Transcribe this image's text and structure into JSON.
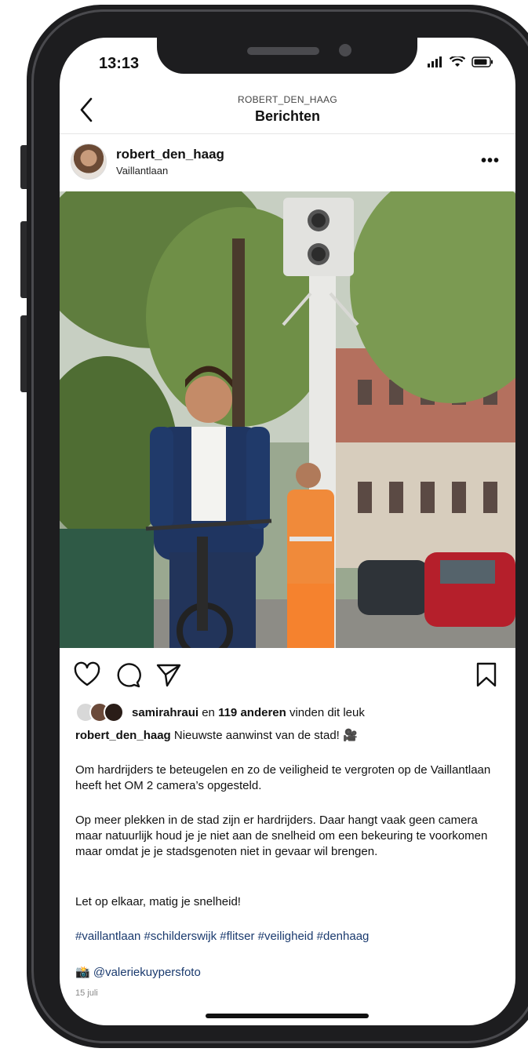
{
  "status_bar": {
    "time": "13:13"
  },
  "nav": {
    "subtitle": "ROBERT_DEN_HAAG",
    "title": "Berichten"
  },
  "post": {
    "username": "robert_den_haag",
    "location": "Vaillantlaan",
    "more_label": "•••",
    "likes": {
      "user": "samirahraui",
      "connector": " en ",
      "count_text": "119 anderen",
      "suffix": " vinden dit leuk"
    },
    "caption_user": "robert_den_haag",
    "caption_first": " Nieuwste aanwinst van de stad! 🎥",
    "paragraph1": "Om hardrijders te beteugelen en zo de veiligheid te vergroten op de Vaillantlaan heeft het OM 2 camera’s opgesteld.",
    "paragraph2": "Op meer plekken in de stad zijn er hardrijders. Daar hangt vaak geen camera maar natuurlijk houd je je niet aan de snelheid om een bekeuring te voorkomen maar omdat je je stadsgenoten niet in gevaar wil brengen.",
    "paragraph3": "Let op elkaar, matig je snelheid!",
    "hashtags": "#vaillantlaan #schilderswijk #flitser #veiligheid #denhaag",
    "credit_emoji": "📸",
    "credit_handle": "@valeriekuypersfoto",
    "date": "15 juli"
  },
  "icons": {
    "back": "chevron-left-icon",
    "like": "heart-icon",
    "comment": "comment-icon",
    "share": "send-icon",
    "save": "bookmark-icon",
    "more": "ellipsis-icon"
  },
  "colors": {
    "link": "#1a3a6e",
    "text": "#111111",
    "muted": "#888888"
  }
}
